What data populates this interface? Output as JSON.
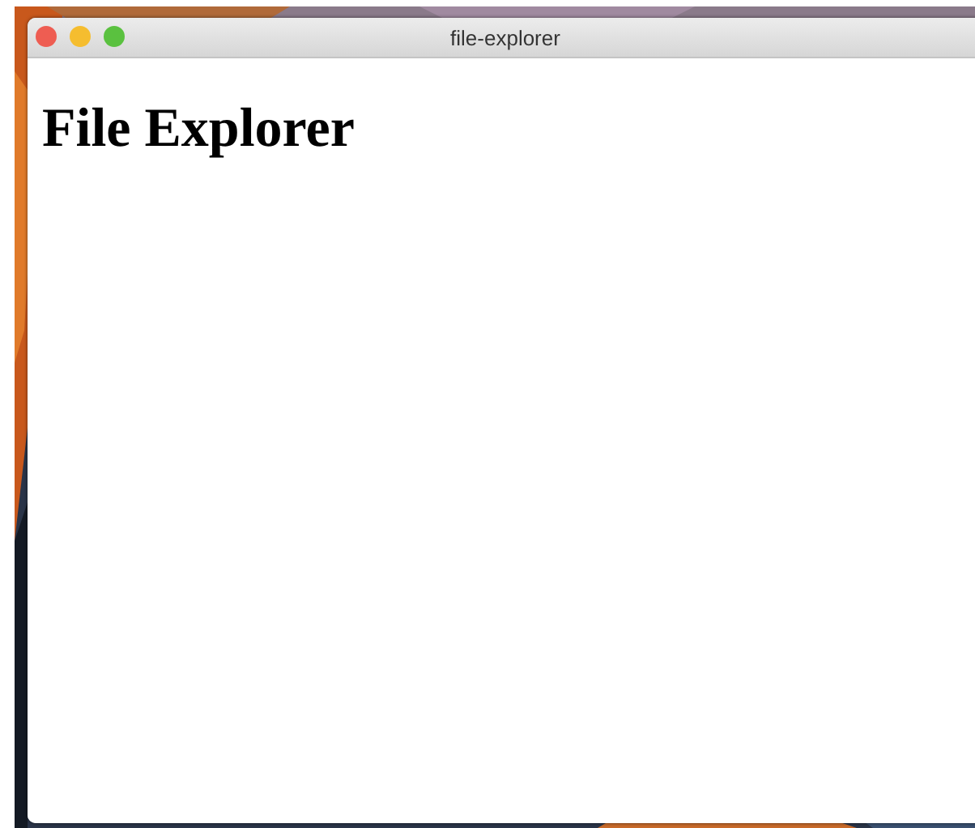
{
  "window": {
    "title": "file-explorer"
  },
  "content": {
    "heading": "File Explorer"
  }
}
